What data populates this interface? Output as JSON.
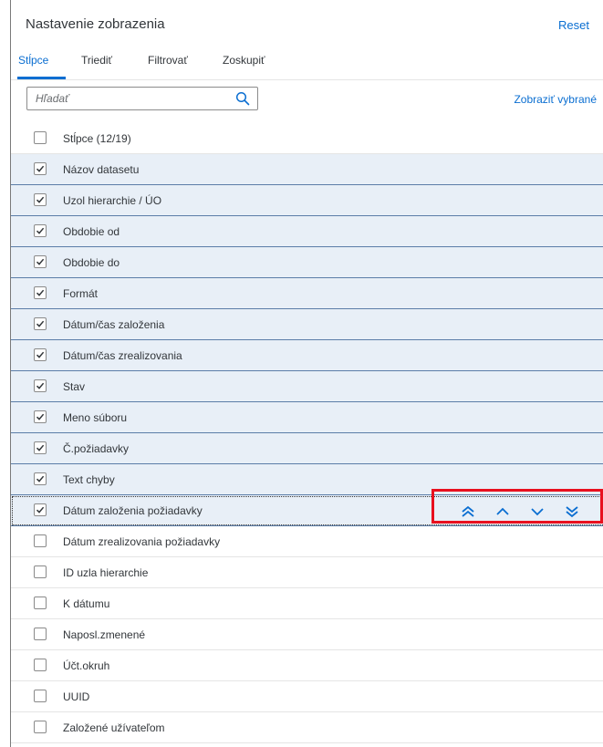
{
  "dialog": {
    "title": "Nastavenie zobrazenia",
    "reset_label": "Reset"
  },
  "tabs": [
    {
      "label": "Stĺpce",
      "active": true
    },
    {
      "label": "Triediť",
      "active": false
    },
    {
      "label": "Filtrovať",
      "active": false
    },
    {
      "label": "Zoskupiť",
      "active": false
    }
  ],
  "toolbar": {
    "search_placeholder": "Hľadať",
    "search_value": "",
    "show_selected_label": "Zobraziť vybrané"
  },
  "select_all": {
    "label": "Stĺpce (12/19)",
    "checked": false
  },
  "columns": [
    {
      "label": "Názov datasetu",
      "checked": true
    },
    {
      "label": "Uzol hierarchie / ÚO",
      "checked": true
    },
    {
      "label": "Obdobie od",
      "checked": true
    },
    {
      "label": "Obdobie do",
      "checked": true
    },
    {
      "label": "Formát",
      "checked": true
    },
    {
      "label": "Dátum/čas založenia",
      "checked": true
    },
    {
      "label": "Dátum/čas zrealizovania",
      "checked": true
    },
    {
      "label": "Stav",
      "checked": true
    },
    {
      "label": "Meno súboru",
      "checked": true
    },
    {
      "label": "Č.požiadavky",
      "checked": true
    },
    {
      "label": "Text chyby",
      "checked": true
    },
    {
      "label": "Dátum založenia požiadavky",
      "checked": true,
      "focused": true
    },
    {
      "label": "Dátum zrealizovania požiadavky",
      "checked": false
    },
    {
      "label": "ID uzla hierarchie",
      "checked": false
    },
    {
      "label": "K dátumu",
      "checked": false
    },
    {
      "label": "Naposl.zmenené",
      "checked": false
    },
    {
      "label": "Účt.okruh",
      "checked": false
    },
    {
      "label": "UUID",
      "checked": false
    },
    {
      "label": "Založené užívateľom",
      "checked": false
    }
  ],
  "move_buttons": [
    {
      "name": "move-to-top-button",
      "icon": "double-chevron-up-icon"
    },
    {
      "name": "move-up-button",
      "icon": "chevron-up-icon"
    },
    {
      "name": "move-down-button",
      "icon": "chevron-down-icon"
    },
    {
      "name": "move-to-bottom-button",
      "icon": "double-chevron-down-icon"
    }
  ],
  "colors": {
    "accent": "#0a6ed1",
    "selected_row": "#e8eff7",
    "highlight_box": "#e8101e"
  }
}
